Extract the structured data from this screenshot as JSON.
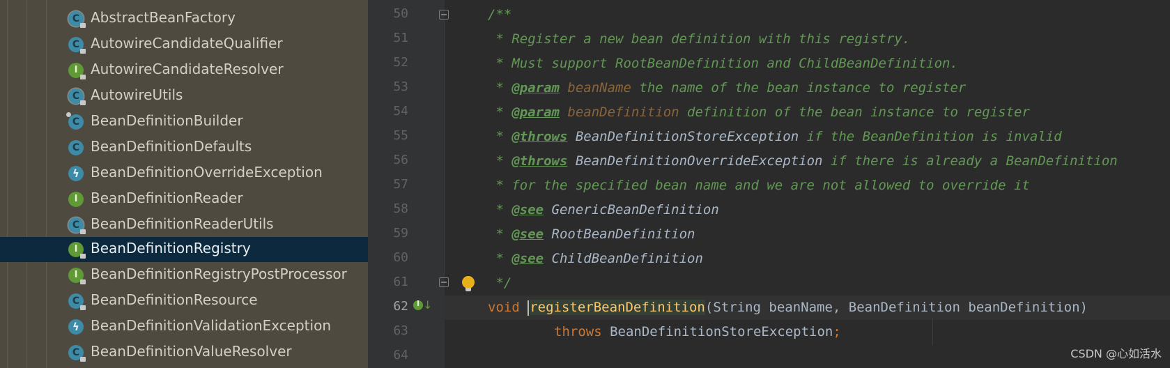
{
  "project_tree": {
    "items": [
      {
        "label": "AbstractBeanFactory",
        "kind": "abstract-class"
      },
      {
        "label": "AutowireCandidateQualifier",
        "kind": "class"
      },
      {
        "label": "AutowireCandidateResolver",
        "kind": "interface"
      },
      {
        "label": "AutowireUtils",
        "kind": "abstract-class"
      },
      {
        "label": "BeanDefinitionBuilder",
        "kind": "class-final"
      },
      {
        "label": "BeanDefinitionDefaults",
        "kind": "class"
      },
      {
        "label": "BeanDefinitionOverrideException",
        "kind": "exception"
      },
      {
        "label": "BeanDefinitionReader",
        "kind": "interface"
      },
      {
        "label": "BeanDefinitionReaderUtils",
        "kind": "abstract-class"
      },
      {
        "label": "BeanDefinitionRegistry",
        "kind": "interface",
        "selected": true
      },
      {
        "label": "BeanDefinitionRegistryPostProcessor",
        "kind": "interface"
      },
      {
        "label": "BeanDefinitionResource",
        "kind": "class"
      },
      {
        "label": "BeanDefinitionValidationException",
        "kind": "exception"
      },
      {
        "label": "BeanDefinitionValueResolver",
        "kind": "class"
      }
    ]
  },
  "editor": {
    "line_numbers": [
      "50",
      "51",
      "52",
      "53",
      "54",
      "55",
      "56",
      "57",
      "58",
      "59",
      "60",
      "61",
      "62",
      "63",
      "64"
    ],
    "current_line": "62",
    "lines": {
      "l50": {
        "c1": "/**"
      },
      "l51": {
        "c1": " * Register a new bean definition with this registry."
      },
      "l52": {
        "c1": " * Must support RootBeanDefinition and ChildBeanDefinition."
      },
      "l53": {
        "c1": " * ",
        "tag": "@param",
        "sp": " ",
        "pn": "beanName",
        "c2": " the name of the bean instance to register"
      },
      "l54": {
        "c1": " * ",
        "tag": "@param",
        "sp": " ",
        "pn": "beanDefinition",
        "c2": " definition of the bean instance to register"
      },
      "l55": {
        "c1": " * ",
        "tag": "@throws",
        "sp": " ",
        "ref": "BeanDefinitionStoreException",
        "c2": " if the BeanDefinition is invalid"
      },
      "l56": {
        "c1": " * ",
        "tag": "@throws",
        "sp": " ",
        "ref": "BeanDefinitionOverrideException",
        "c2": " if there is already a BeanDefinition"
      },
      "l57": {
        "c1": " * for the specified bean name and we are not allowed to override it"
      },
      "l58": {
        "c1": " * ",
        "tag": "@see",
        "sp": " ",
        "ref": "GenericBeanDefinition"
      },
      "l59": {
        "c1": " * ",
        "tag": "@see",
        "sp": " ",
        "ref": "RootBeanDefinition"
      },
      "l60": {
        "c1": " * ",
        "tag": "@see",
        "sp": " ",
        "ref": "ChildBeanDefinition"
      },
      "l61": {
        "c1": " */"
      },
      "l62": {
        "kw": "void",
        "sp": " ",
        "fn": "registerBeanDefinition",
        "tx": "(String beanName, BeanDefinition beanDefinition)"
      },
      "l63": {
        "kw": "throws",
        "tx": " BeanDefinitionStoreException",
        "semi": ";"
      }
    }
  },
  "gutter_icons": {
    "implemented": "implemented-interface-icon",
    "bulb": "lightbulb-icon",
    "fold": "fold-icon"
  },
  "watermark": "CSDN @心如活水"
}
